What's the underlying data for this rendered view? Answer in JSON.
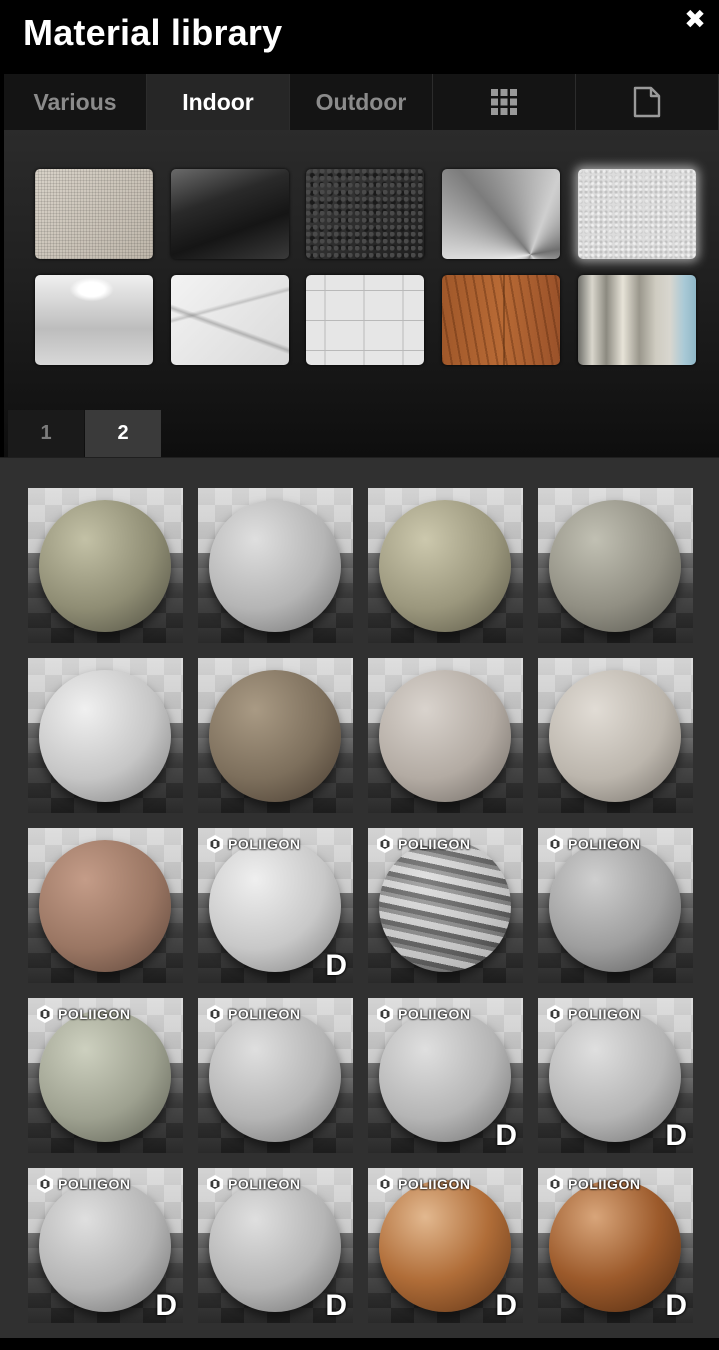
{
  "window": {
    "title": "Material library",
    "close_icon": "close-icon"
  },
  "tabs": [
    {
      "label": "Various",
      "active": false
    },
    {
      "label": "Indoor",
      "active": true
    },
    {
      "label": "Outdoor",
      "active": false
    },
    {
      "label": "",
      "icon": "grid-icon",
      "active": false
    },
    {
      "label": "",
      "icon": "document-icon",
      "active": false
    }
  ],
  "swatches": [
    {
      "name": "fabric",
      "selected": false
    },
    {
      "name": "glossy-dark",
      "selected": false
    },
    {
      "name": "leather",
      "selected": false
    },
    {
      "name": "brushed-metal",
      "selected": false
    },
    {
      "name": "plaster",
      "selected": true
    },
    {
      "name": "white-glossy",
      "selected": false
    },
    {
      "name": "marble",
      "selected": false
    },
    {
      "name": "tiles",
      "selected": false
    },
    {
      "name": "wood",
      "selected": false
    },
    {
      "name": "curtain",
      "selected": false
    }
  ],
  "pages": [
    {
      "label": "1",
      "active": false
    },
    {
      "label": "2",
      "active": true
    }
  ],
  "brand_label": "POLIIGON",
  "badge_label": "D",
  "materials": [
    {
      "sphere": "stone-beige",
      "brand": false,
      "badge": false
    },
    {
      "sphere": "light-grey",
      "brand": false,
      "badge": false
    },
    {
      "sphere": "sand",
      "brand": false,
      "badge": false
    },
    {
      "sphere": "grey-stone",
      "brand": false,
      "badge": false
    },
    {
      "sphere": "white-plaster",
      "brand": false,
      "badge": false
    },
    {
      "sphere": "brown-stone",
      "brand": false,
      "badge": false
    },
    {
      "sphere": "pale-pink",
      "brand": false,
      "badge": false
    },
    {
      "sphere": "pale-cream",
      "brand": false,
      "badge": false
    },
    {
      "sphere": "terracotta",
      "brand": false,
      "badge": false
    },
    {
      "sphere": "white-rough",
      "brand": true,
      "badge": true
    },
    {
      "sphere": "striped-marble",
      "brand": true,
      "badge": false
    },
    {
      "sphere": "grey-concrete",
      "brand": true,
      "badge": false
    },
    {
      "sphere": "green-concrete",
      "brand": true,
      "badge": false
    },
    {
      "sphere": "light-grey",
      "brand": true,
      "badge": false
    },
    {
      "sphere": "light-grey",
      "brand": true,
      "badge": true
    },
    {
      "sphere": "light-grey",
      "brand": true,
      "badge": true
    },
    {
      "sphere": "light-grey",
      "brand": true,
      "badge": true
    },
    {
      "sphere": "light-grey",
      "brand": true,
      "badge": true
    },
    {
      "sphere": "orange-leather",
      "brand": true,
      "badge": true
    },
    {
      "sphere": "brown-leather",
      "brand": true,
      "badge": true
    }
  ]
}
